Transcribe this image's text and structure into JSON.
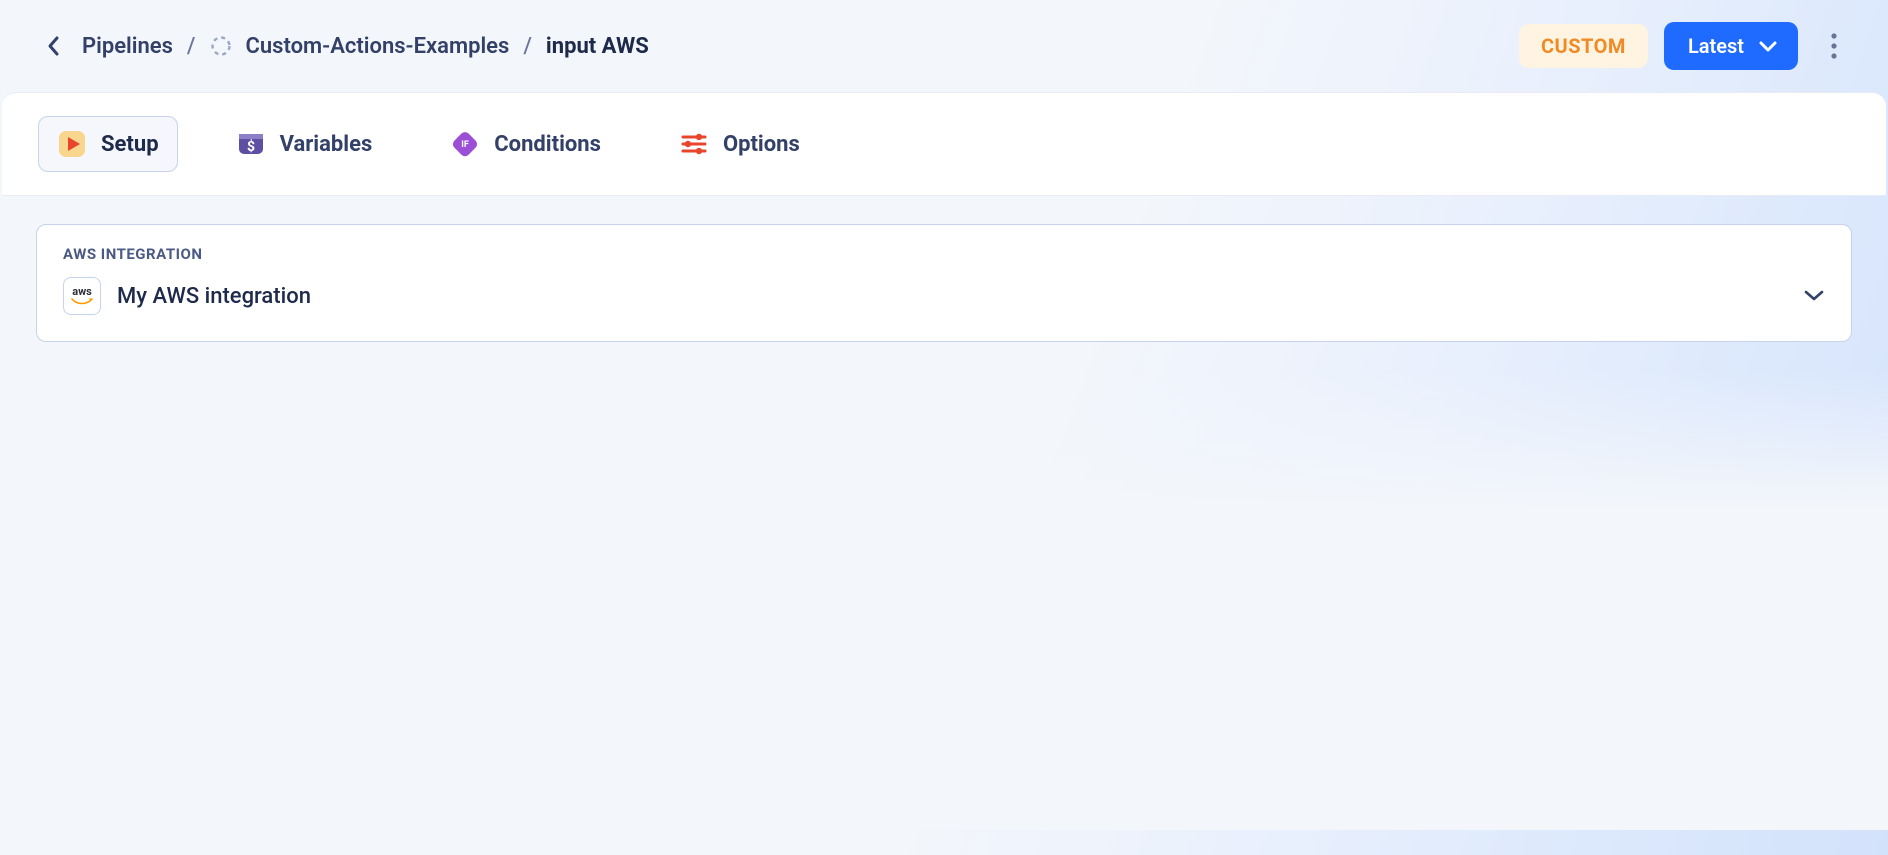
{
  "breadcrumb": {
    "root": "Pipelines",
    "project": "Custom-Actions-Examples",
    "current": "input AWS"
  },
  "header": {
    "custom_badge": "CUSTOM",
    "version_button": "Latest"
  },
  "tabs": {
    "setup": {
      "label": "Setup"
    },
    "variables": {
      "label": "Variables"
    },
    "conditions": {
      "label": "Conditions"
    },
    "options": {
      "label": "Options"
    }
  },
  "integration_card": {
    "section_label": "AWS INTEGRATION",
    "aws_logo_text": "aws",
    "selected_value": "My AWS integration"
  }
}
